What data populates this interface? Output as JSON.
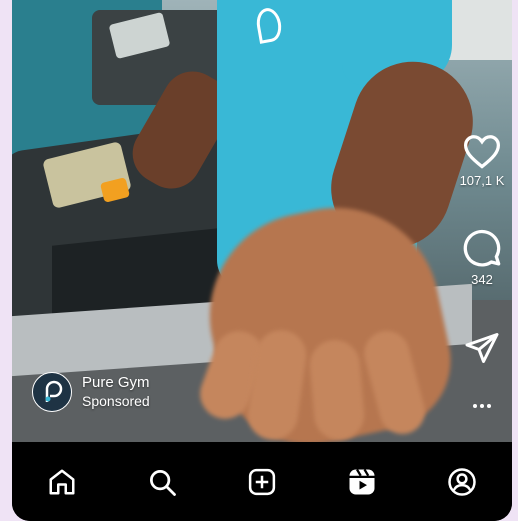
{
  "post": {
    "likes": "107,1 K",
    "comments": "342"
  },
  "account": {
    "name": "Pure Gym",
    "label": "Sponsored"
  },
  "icons": {
    "like": "heart-icon",
    "comment": "comment-icon",
    "share": "send-icon",
    "more": "more-icon"
  },
  "nav": {
    "items": [
      "home-icon",
      "search-icon",
      "create-icon",
      "reels-icon",
      "profile-icon"
    ]
  },
  "colors": {
    "shirt": "#39b8d6",
    "nav_bg": "#000000",
    "icon": "#ffffff"
  }
}
